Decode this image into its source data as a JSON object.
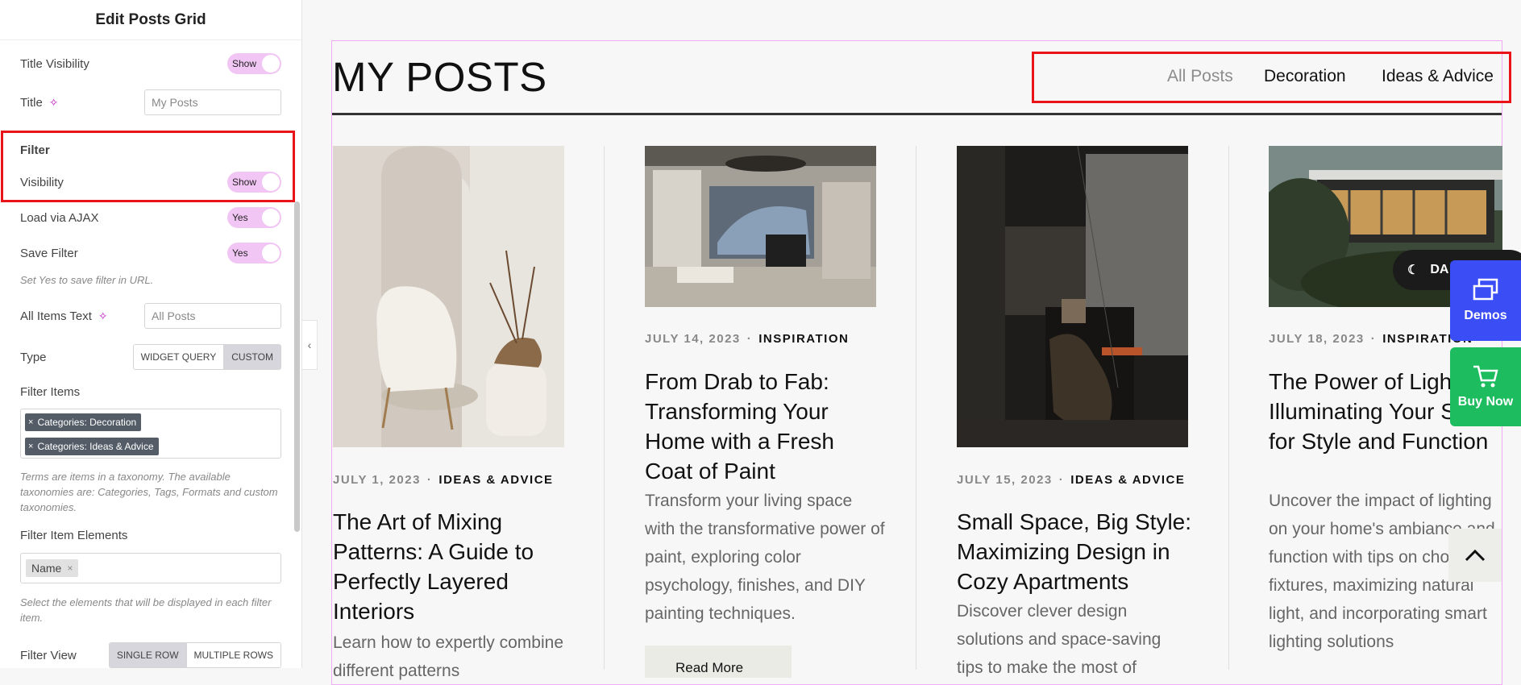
{
  "panel": {
    "header": "Edit Posts Grid",
    "title_visibility": {
      "label": "Title Visibility",
      "value": "Show"
    },
    "title": {
      "label": "Title",
      "value": "My Posts"
    },
    "filter_section": "Filter",
    "visibility": {
      "label": "Visibility",
      "value": "Show"
    },
    "load_ajax": {
      "label": "Load via AJAX",
      "value": "Yes"
    },
    "save_filter": {
      "label": "Save Filter",
      "value": "Yes",
      "hint": "Set Yes to save filter in URL."
    },
    "all_items_text": {
      "label": "All Items Text",
      "value": "All Posts"
    },
    "type": {
      "label": "Type",
      "options": [
        "WIDGET QUERY",
        "CUSTOM"
      ],
      "selected": "CUSTOM"
    },
    "filter_items": {
      "label": "Filter Items",
      "chips": [
        "Categories: Decoration",
        "Categories: Ideas & Advice"
      ],
      "hint": "Terms are items in a taxonomy. The available taxonomies are: Categories, Tags, Formats and custom taxonomies."
    },
    "filter_item_elements": {
      "label": "Filter Item Elements",
      "chips": [
        "Name"
      ],
      "hint": "Select the elements that will be displayed in each filter item."
    },
    "filter_view": {
      "label": "Filter View",
      "options": [
        "SINGLE ROW",
        "MULTIPLE ROWS"
      ],
      "selected": "SINGLE ROW"
    }
  },
  "preview": {
    "title": "MY POSTS",
    "filters": [
      "All Posts",
      "Decoration",
      "Ideas & Advice"
    ],
    "active_filter": "All Posts",
    "posts": [
      {
        "date": "JULY 1, 2023",
        "category": "IDEAS & ADVICE",
        "title": "The Art of Mixing Patterns: A Guide to Perfectly Layered Interiors",
        "excerpt": "Learn how to expertly combine different patterns"
      },
      {
        "date": "JULY 14, 2023",
        "category": "INSPIRATION",
        "title": "From Drab to Fab: Transforming Your Home with a Fresh Coat of Paint",
        "excerpt": "Transform your living space with the transformative power of paint, exploring color psychology, finishes, and DIY painting techniques.",
        "read_more": "Read More"
      },
      {
        "date": "JULY 15, 2023",
        "category": "IDEAS & ADVICE",
        "title": "Small Space, Big Style: Maximizing Design in Cozy Apartments",
        "excerpt": "Discover clever design solutions and space-saving tips to make the most of"
      },
      {
        "date": "JULY 18, 2023",
        "category": "INSPIRATION",
        "title": "The Power of Light: Illuminating Your Space for Style and Function",
        "excerpt": "Uncover the impact of lighting on your home's ambiance and function with tips on choosing fixtures, maximizing natural light, and incorporating smart lighting solutions"
      }
    ],
    "dark_toggle": "DA",
    "demos": "Demos",
    "buy_now": "Buy Now"
  },
  "colors": {
    "accent_pink": "#f2c6f4",
    "highlight_red": "#e8141a",
    "demos_blue": "#3b4ef5",
    "buy_green": "#1dbc5f"
  }
}
